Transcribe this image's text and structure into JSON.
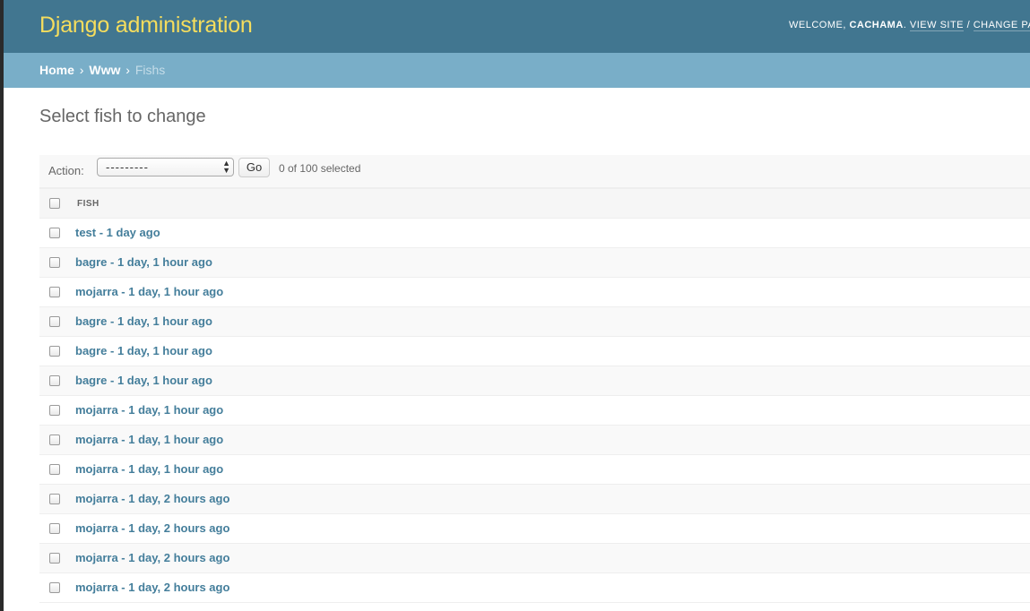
{
  "header": {
    "branding": "Django administration",
    "welcome": "WELCOME, ",
    "username": "CACHAMA",
    "after_user": ". ",
    "view_site": "VIEW SITE",
    "separator": " / ",
    "change_password": "CHANGE PASSWORD"
  },
  "breadcrumbs": {
    "home": "Home",
    "app": "Www",
    "current": "Fishs",
    "sep": "›"
  },
  "page": {
    "title": "Select fish to change"
  },
  "actions": {
    "label": "Action:",
    "selected_value": "---------",
    "go_label": "Go",
    "counter": "0 of 100 selected"
  },
  "table": {
    "column_header": "FISH",
    "rows": [
      "test - 1 day ago",
      "bagre - 1 day, 1 hour ago",
      "mojarra - 1 day, 1 hour ago",
      "bagre - 1 day, 1 hour ago",
      "bagre - 1 day, 1 hour ago",
      "bagre - 1 day, 1 hour ago",
      "mojarra - 1 day, 1 hour ago",
      "mojarra - 1 day, 1 hour ago",
      "mojarra - 1 day, 1 hour ago",
      "mojarra - 1 day, 2 hours ago",
      "mojarra - 1 day, 2 hours ago",
      "mojarra - 1 day, 2 hours ago",
      "mojarra - 1 day, 2 hours ago"
    ]
  },
  "colors": {
    "header_bg": "#417690",
    "branding": "#f5dd5d",
    "breadcrumbs_bg": "#79aec8",
    "link": "#447e9b"
  }
}
